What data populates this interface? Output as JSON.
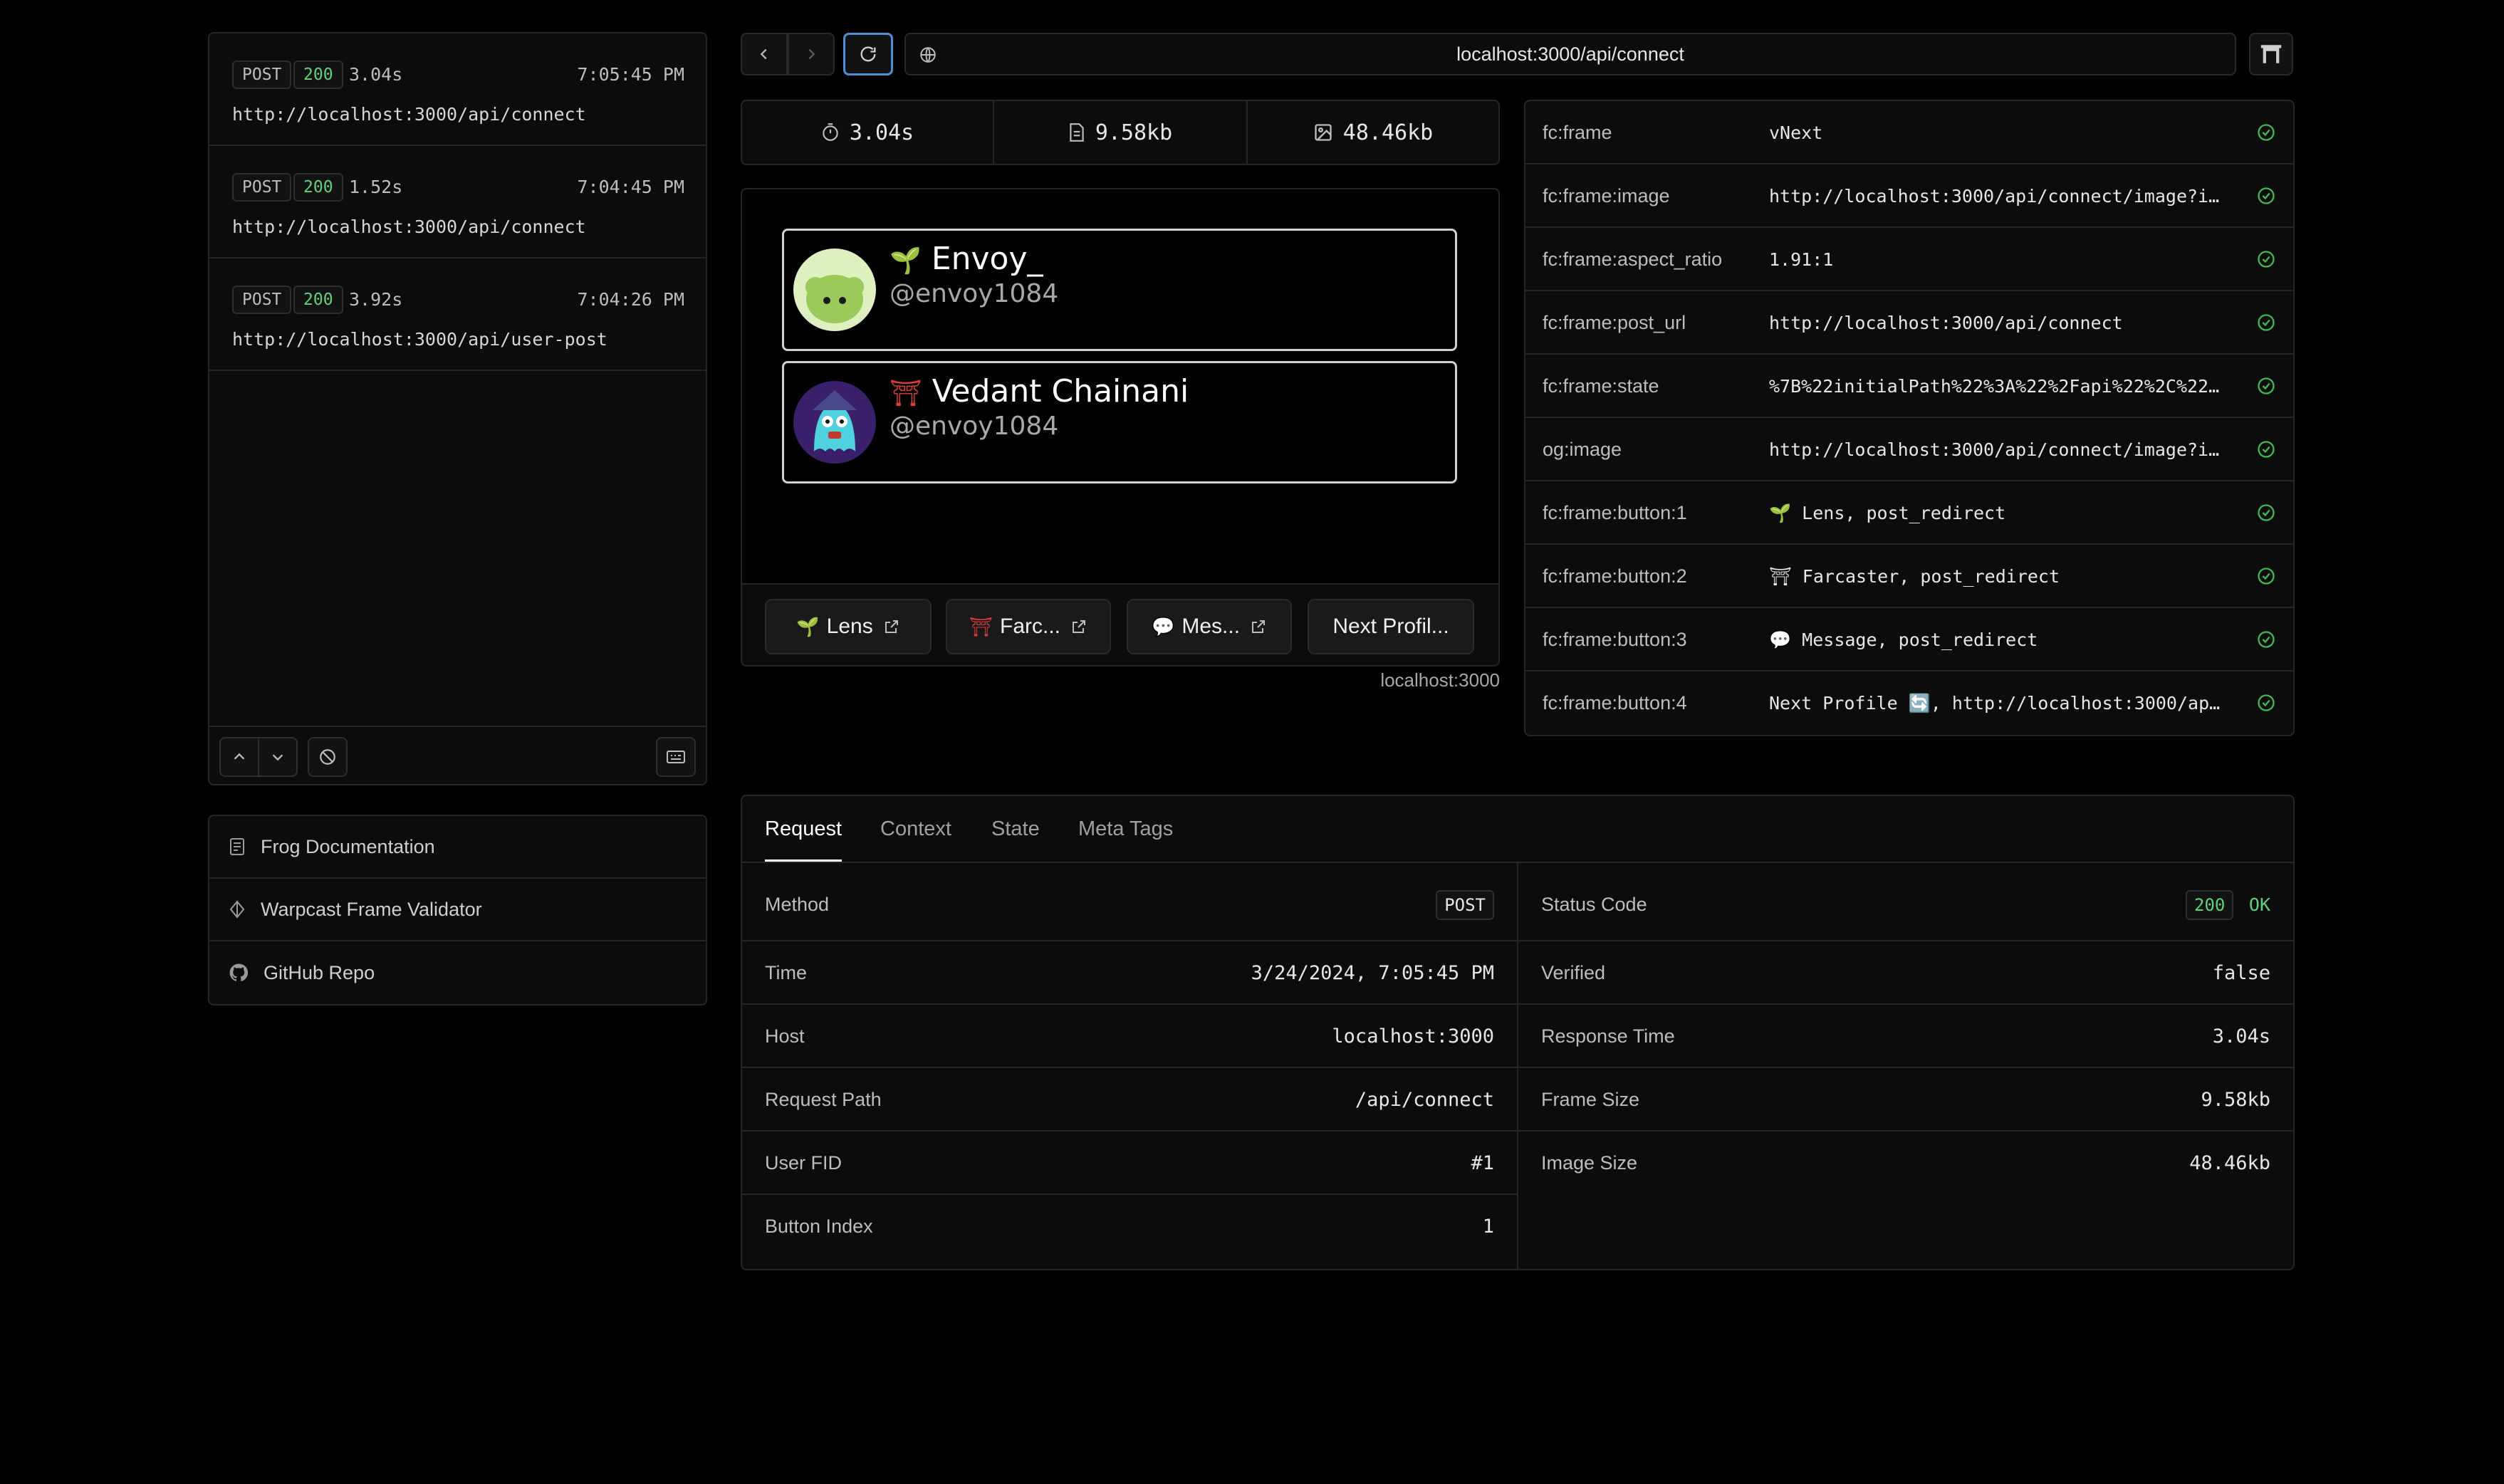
{
  "history": [
    {
      "method": "POST",
      "status": "200",
      "duration": "3.04s",
      "time": "7:05:45 PM",
      "url": "http://localhost:3000/api/connect"
    },
    {
      "method": "POST",
      "status": "200",
      "duration": "1.52s",
      "time": "7:04:45 PM",
      "url": "http://localhost:3000/api/connect"
    },
    {
      "method": "POST",
      "status": "200",
      "duration": "3.92s",
      "time": "7:04:26 PM",
      "url": "http://localhost:3000/api/user-post"
    }
  ],
  "links": [
    {
      "label": "Frog Documentation",
      "icon": "document-icon"
    },
    {
      "label": "Warpcast Frame Validator",
      "icon": "warpcast-icon"
    },
    {
      "label": "GitHub Repo",
      "icon": "github-icon"
    }
  ],
  "address_bar": {
    "url": "localhost:3000/api/connect"
  },
  "metrics": {
    "time": "3.04s",
    "frame_size": "9.58kb",
    "image_size": "48.46kb"
  },
  "frame": {
    "profiles": [
      {
        "emoji": "🌱",
        "name": "Envoy_",
        "handle": "@envoy1084"
      },
      {
        "emoji": "⛩",
        "name": "Vedant Chainani",
        "handle": "@envoy1084"
      }
    ],
    "buttons": [
      {
        "emoji": "🌱",
        "label": "Lens",
        "external": true
      },
      {
        "emoji": "⛩",
        "label": "Farc...",
        "external": true
      },
      {
        "emoji": "💬",
        "label": "Mes...",
        "external": true
      },
      {
        "emoji": "",
        "label": "Next Profil...",
        "external": false
      }
    ],
    "host": "localhost:3000"
  },
  "meta_tags": [
    {
      "key": "fc:frame",
      "value": "vNext"
    },
    {
      "key": "fc:frame:image",
      "value": "http://localhost:3000/api/connect/image?im…"
    },
    {
      "key": "fc:frame:aspect_ratio",
      "value": "1.91:1"
    },
    {
      "key": "fc:frame:post_url",
      "value": "http://localhost:3000/api/connect"
    },
    {
      "key": "fc:frame:state",
      "value": "%7B%22initialPath%22%3A%22%2Fapi%22%2C%22p…"
    },
    {
      "key": "og:image",
      "value": "http://localhost:3000/api/connect/image?im…"
    },
    {
      "key": "fc:frame:button:1",
      "value": "🌱 Lens, post_redirect"
    },
    {
      "key": "fc:frame:button:2",
      "value": "⛩ Farcaster, post_redirect"
    },
    {
      "key": "fc:frame:button:3",
      "value": "💬 Message, post_redirect"
    },
    {
      "key": "fc:frame:button:4",
      "value": "Next Profile 🔄, http://localhost:3000/api/c…"
    }
  ],
  "tabs": [
    "Request",
    "Context",
    "State",
    "Meta Tags"
  ],
  "request": {
    "method_label": "Method",
    "method": "POST",
    "time_label": "Time",
    "time": "3/24/2024, 7:05:45 PM",
    "host_label": "Host",
    "host": "localhost:3000",
    "path_label": "Request Path",
    "path": "/api/connect",
    "fid_label": "User FID",
    "fid": "#1",
    "button_label": "Button Index",
    "button": "1"
  },
  "response": {
    "status_label": "Status Code",
    "status_code": "200",
    "status_text": "OK",
    "verified_label": "Verified",
    "verified": "false",
    "rt_label": "Response Time",
    "rt": "3.04s",
    "fs_label": "Frame Size",
    "fs": "9.58kb",
    "is_label": "Image Size",
    "is": "48.46kb"
  },
  "colors": {
    "accent": "#4f8fd8",
    "success": "#3fb950",
    "background": "#000000",
    "panel": "#0c0c0c",
    "border": "#262626"
  }
}
